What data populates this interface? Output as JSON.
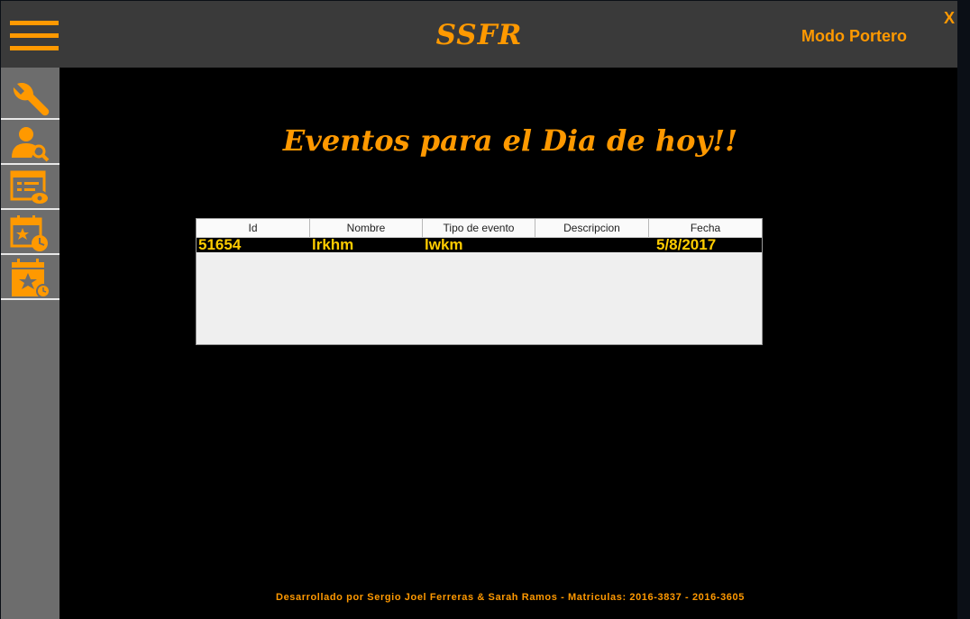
{
  "app": {
    "title": "SSFR",
    "mode_label": "Modo Portero",
    "close_label": "X"
  },
  "colors": {
    "accent": "#ff9900",
    "row_text": "#ffcc00",
    "topbar": "#3a3a3a",
    "sidebar": "#6d6d6d",
    "background": "#000000"
  },
  "sidebar": {
    "items": [
      {
        "icon": "wrench-icon"
      },
      {
        "icon": "user-search-icon"
      },
      {
        "icon": "list-view-icon"
      },
      {
        "icon": "calendar-clock-icon"
      },
      {
        "icon": "calendar-star-clock-icon"
      }
    ]
  },
  "main": {
    "heading": "Eventos para el Dia de hoy!!",
    "table": {
      "columns": [
        "Id",
        "Nombre",
        "Tipo de evento",
        "Descripcion",
        "Fecha"
      ],
      "rows": [
        {
          "id": "51654",
          "nombre": "lrkhm",
          "tipo": "lwkm",
          "descripcion": "",
          "fecha": "5/8/2017"
        }
      ]
    }
  },
  "footer": {
    "text": "Desarrollado por Sergio Joel Ferreras & Sarah Ramos - Matriculas: 2016-3837 - 2016-3605"
  }
}
